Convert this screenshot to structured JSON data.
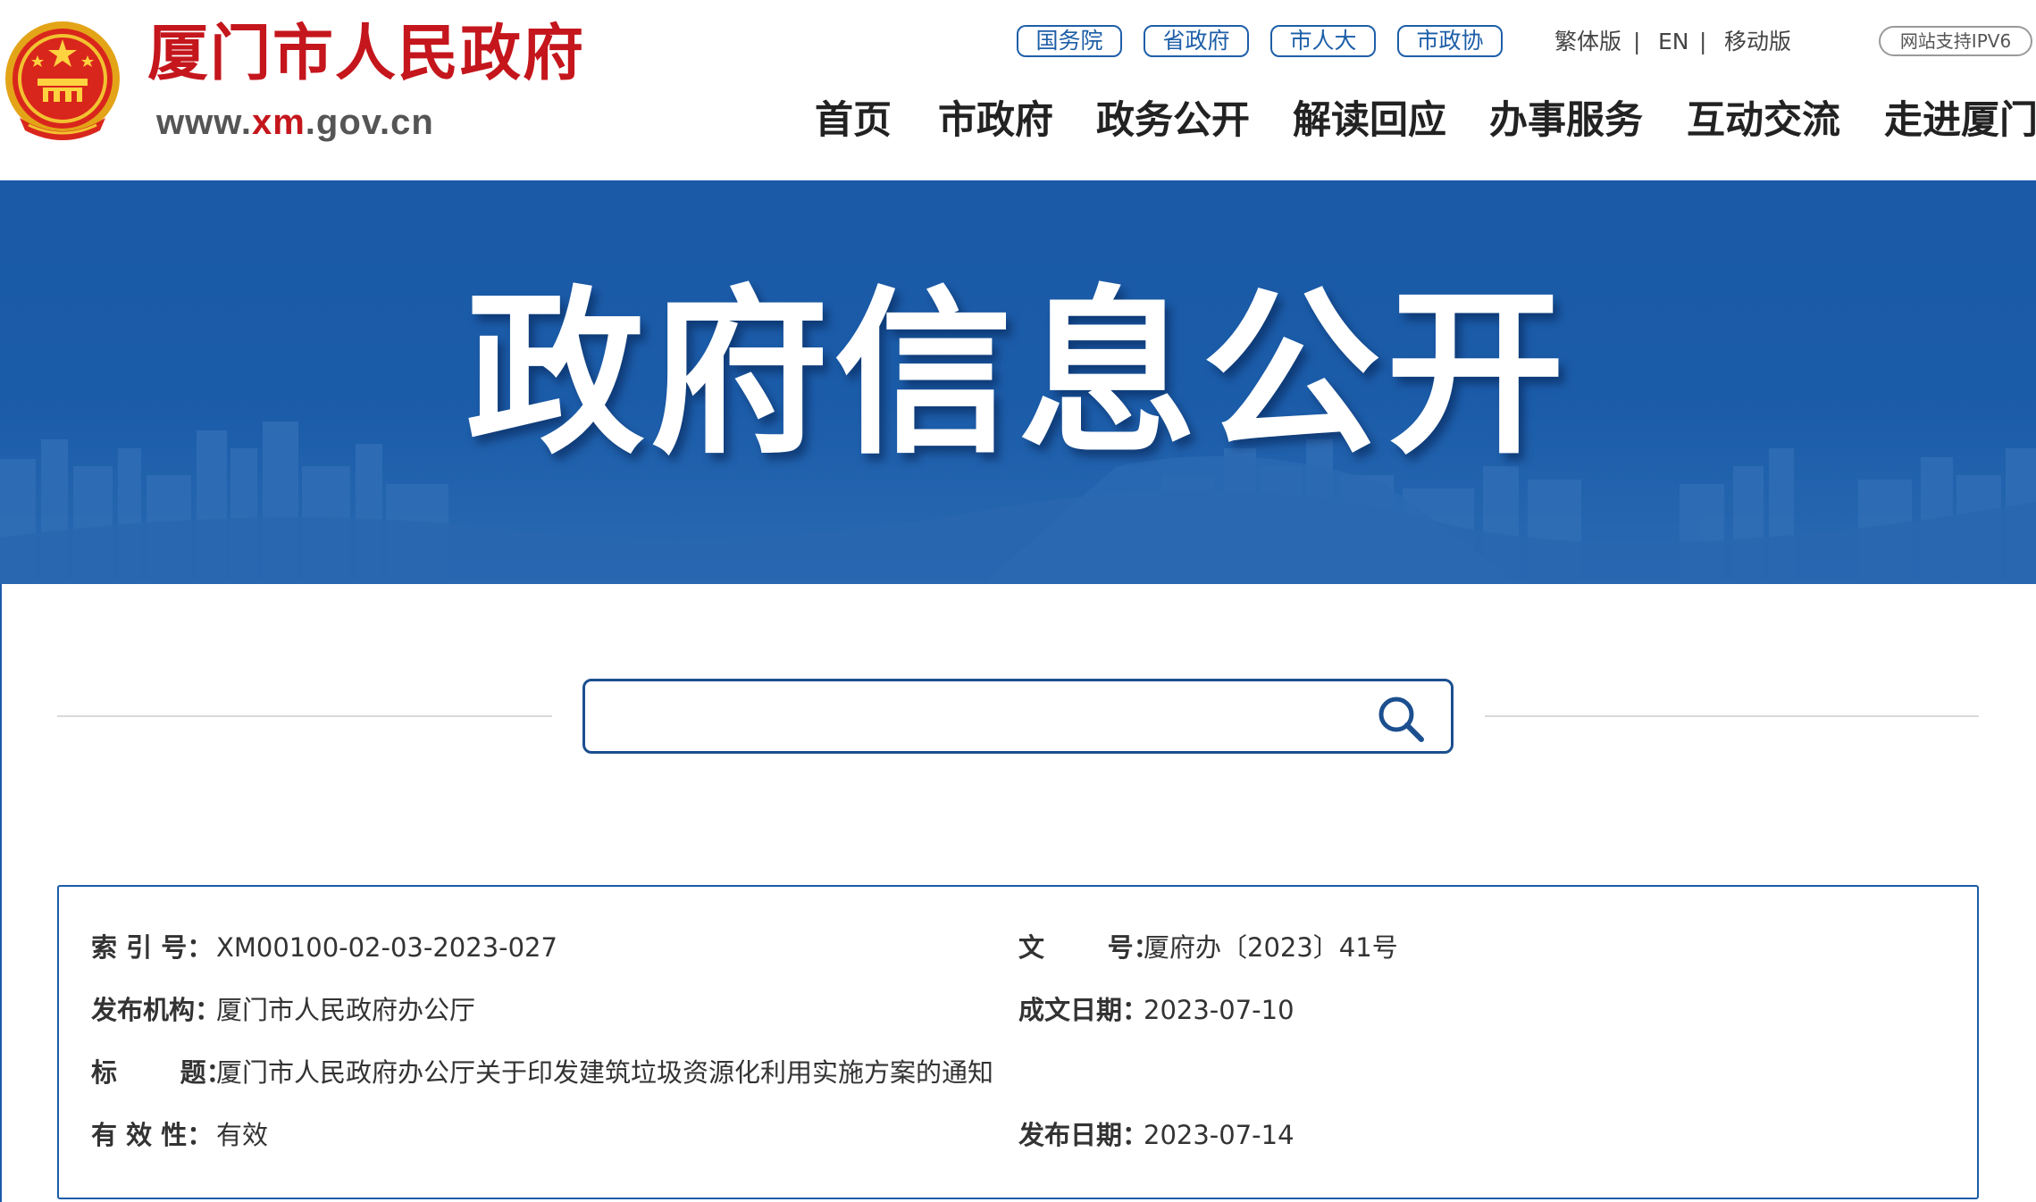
{
  "header": {
    "site_name": "厦门市人民政府",
    "site_url_prefix": "www.",
    "site_url_highlight": "xm",
    "site_url_suffix": ".gov.cn",
    "gov_links": [
      "国务院",
      "省政府",
      "市人大",
      "市政协"
    ],
    "util_links": {
      "traditional": "繁体版",
      "english": "EN",
      "mobile": "移动版",
      "separator": "|"
    },
    "ipv6_badge": "网站支持IPV6",
    "nav": [
      "首页",
      "市政府",
      "政务公开",
      "解读回应",
      "办事服务",
      "互动交流",
      "走进厦门"
    ]
  },
  "banner": {
    "title": "政府信息公开"
  },
  "search": {
    "value": "",
    "placeholder": ""
  },
  "doc_info": {
    "index_label": "索 引 号：",
    "index_value": "XM00100-02-03-2023-027",
    "doc_no_label": "文       号：",
    "doc_no_value": "厦府办〔2023〕41号",
    "publisher_label": "发布机构：",
    "publisher_value": "厦门市人民政府办公厅",
    "written_date_label": "成文日期：",
    "written_date_value": "2023-07-10",
    "title_label": "标       题：",
    "title_value": "厦门市人民政府办公厅关于印发建筑垃圾资源化利用实施方案的通知",
    "validity_label": "有 效 性：",
    "validity_value": "有效",
    "publish_date_label": "发布日期：",
    "publish_date_value": "2023-07-14"
  },
  "colors": {
    "brand_red": "#c4161c",
    "gov_blue": "#1b5ca9",
    "link_blue": "#1e5fa8"
  }
}
